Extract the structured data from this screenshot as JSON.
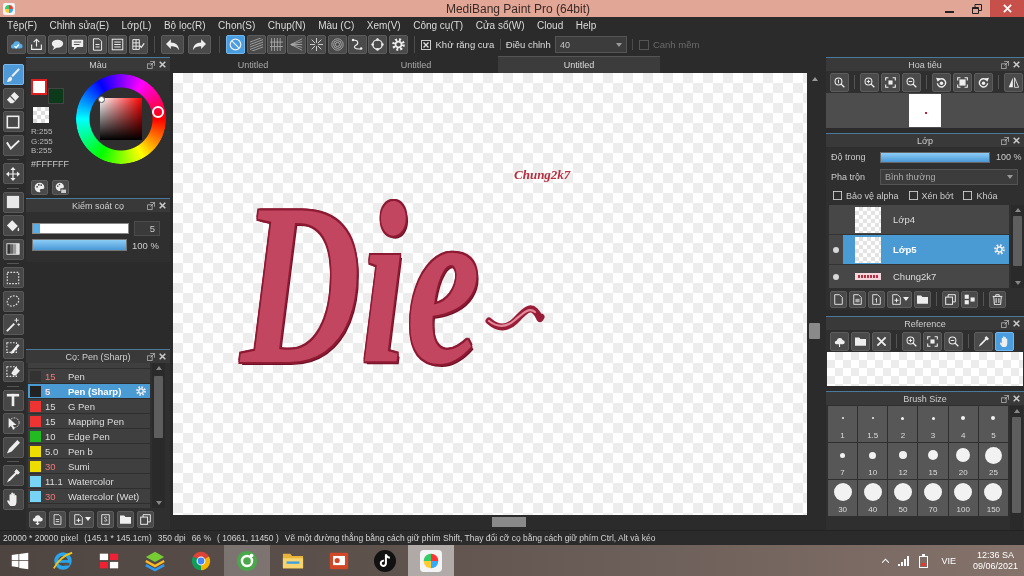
{
  "window": {
    "title": "MediBang Paint Pro (64bit)"
  },
  "menu": [
    "Tệp(F)",
    "Chỉnh sửa(E)",
    "Lớp(L)",
    "Bộ lọc(R)",
    "Chọn(S)",
    "Chụp(N)",
    "Màu (C)",
    "Xem(V)",
    "Công cụ(T)",
    "Cửa sổ(W)",
    "Cloud",
    "Help"
  ],
  "toolbar": {
    "snap_modes": [
      {
        "selected": true
      },
      {
        "selected": false
      },
      {
        "selected": false
      },
      {
        "selected": false
      },
      {
        "selected": false
      },
      {
        "selected": false
      },
      {
        "selected": false
      },
      {
        "selected": false
      }
    ],
    "antialias": {
      "label": "Khử răng cưa",
      "checked": true
    },
    "correction": {
      "label": "Điều chỉnh",
      "value": "40"
    },
    "soft_edge": {
      "label": "Canh mềm",
      "checked": false,
      "disabled": true
    }
  },
  "tools": [
    [
      {
        "selected": true
      },
      {
        "selected": false
      },
      {
        "selected": false
      },
      {
        "selected": false
      }
    ],
    [
      {
        "selected": false
      }
    ],
    [
      {
        "selected": false
      },
      {
        "selected": false
      },
      {
        "selected": false
      }
    ],
    [
      {
        "selected": false
      },
      {
        "selected": false
      },
      {
        "selected": false
      },
      {
        "selected": false
      },
      {
        "selected": false
      }
    ],
    [
      {
        "selected": false
      },
      {
        "selected": false
      },
      {
        "selected": false
      }
    ],
    [
      {
        "selected": false
      },
      {
        "selected": false
      }
    ]
  ],
  "color_panel": {
    "title": "Màu",
    "swatches": [
      {
        "color": "#ffffff",
        "selected": true
      },
      {
        "color": "#0d3a1b",
        "selected": false
      }
    ],
    "readings": [
      "R:255",
      "G:255",
      "B:255"
    ],
    "hex": "#FFFFFF"
  },
  "brush_control": {
    "title": "Kiểm soát cọ",
    "size": {
      "level": 0.07,
      "value": "5"
    },
    "opacity": {
      "level": 1,
      "reading": "100 %"
    }
  },
  "brush_panel": {
    "title": "Cọ: Pen (Sharp)",
    "brushes": [
      {
        "size": "15",
        "size_accent": true,
        "name": "Pen",
        "color": "#333333",
        "selected": false
      },
      {
        "size": "5",
        "size_accent": true,
        "name": "Pen (Sharp)",
        "color": "#222222",
        "selected": true
      },
      {
        "size": "15",
        "size_accent": false,
        "name": "G Pen",
        "color": "#ee3333",
        "selected": false
      },
      {
        "size": "15",
        "size_accent": false,
        "name": "Mapping Pen",
        "color": "#ee3333",
        "selected": false
      },
      {
        "size": "10",
        "size_accent": false,
        "name": "Edge Pen",
        "color": "#22bb22",
        "selected": false
      },
      {
        "size": "5.0",
        "size_accent": false,
        "name": "Pen b",
        "color": "#eedd00",
        "selected": false
      },
      {
        "size": "30",
        "size_accent": true,
        "name": "Sumi",
        "color": "#eedd00",
        "selected": false
      },
      {
        "size": "11.1",
        "size_accent": false,
        "name": "Watercolor",
        "color": "#77d4f4",
        "selected": false
      },
      {
        "size": "30",
        "size_accent": true,
        "name": "Watercolor (Wet)",
        "color": "#77d4f4",
        "selected": false
      }
    ]
  },
  "canvas": {
    "tabs": [
      {
        "label": "Untitled",
        "selected": false
      },
      {
        "label": "Untitled",
        "selected": false
      },
      {
        "label": "Untitled",
        "selected": true
      }
    ],
    "signature": "Chung2k7",
    "lettering": "Die"
  },
  "navigator": {
    "title": "Hoa tiêu"
  },
  "layers": {
    "title": "Lớp",
    "opacity": {
      "label": "Độ trong",
      "level": 1,
      "reading": "100 %"
    },
    "blend": {
      "label": "Pha trộn",
      "value": "Bình thường"
    },
    "options": [
      {
        "label": "Bảo vệ alpha",
        "checked": false
      },
      {
        "label": "Xén bớt",
        "checked": false
      },
      {
        "label": "Khóa",
        "checked": false
      }
    ],
    "items": [
      {
        "name": "Lớp4",
        "kind": "blank",
        "visible": false,
        "selected": false
      },
      {
        "name": "Lớp5",
        "kind": "blank",
        "visible": true,
        "selected": true
      },
      {
        "name": "Chung2k7",
        "kind": "lettering",
        "visible": true,
        "selected": false
      }
    ]
  },
  "reference": {
    "title": "Reference",
    "tools": [
      {
        "selected": false
      },
      {
        "selected": false
      },
      {
        "selected": false
      },
      {
        "selected": false
      },
      {
        "selected": false
      },
      {
        "selected": false
      },
      {
        "selected": false
      },
      {
        "selected": true
      }
    ]
  },
  "brush_size": {
    "title": "Brush Size",
    "sizes": [
      "1",
      "1.5",
      "2",
      "3",
      "4",
      "5",
      "7",
      "10",
      "12",
      "15",
      "20",
      "25",
      "30",
      "40",
      "50",
      "70",
      "100",
      "150"
    ]
  },
  "status_bar": {
    "fields": [
      "20000 * 20000 pixel",
      "(145.1 * 145.1cm)",
      "350 dpi",
      "66 %",
      "( 10661, 11450 )"
    ],
    "hint": "Vẽ một đường thẳng bằng cách giữ phím Shift, Thay đổi cỡ cọ bằng cách giữ phím Ctrl, Alt và kéo"
  },
  "taskbar": {
    "apps": [
      {
        "running": false,
        "selected": false
      },
      {
        "running": false,
        "selected": false
      },
      {
        "running": false,
        "selected": false
      },
      {
        "running": false,
        "selected": false
      },
      {
        "running": true,
        "selected": false
      },
      {
        "running": false,
        "selected": false
      },
      {
        "running": false,
        "selected": false
      },
      {
        "running": false,
        "selected": false
      },
      {
        "running": true,
        "selected": true
      }
    ],
    "tray": {
      "language": "VIE",
      "time": "12:36 SA",
      "date": "09/06/2021"
    }
  }
}
